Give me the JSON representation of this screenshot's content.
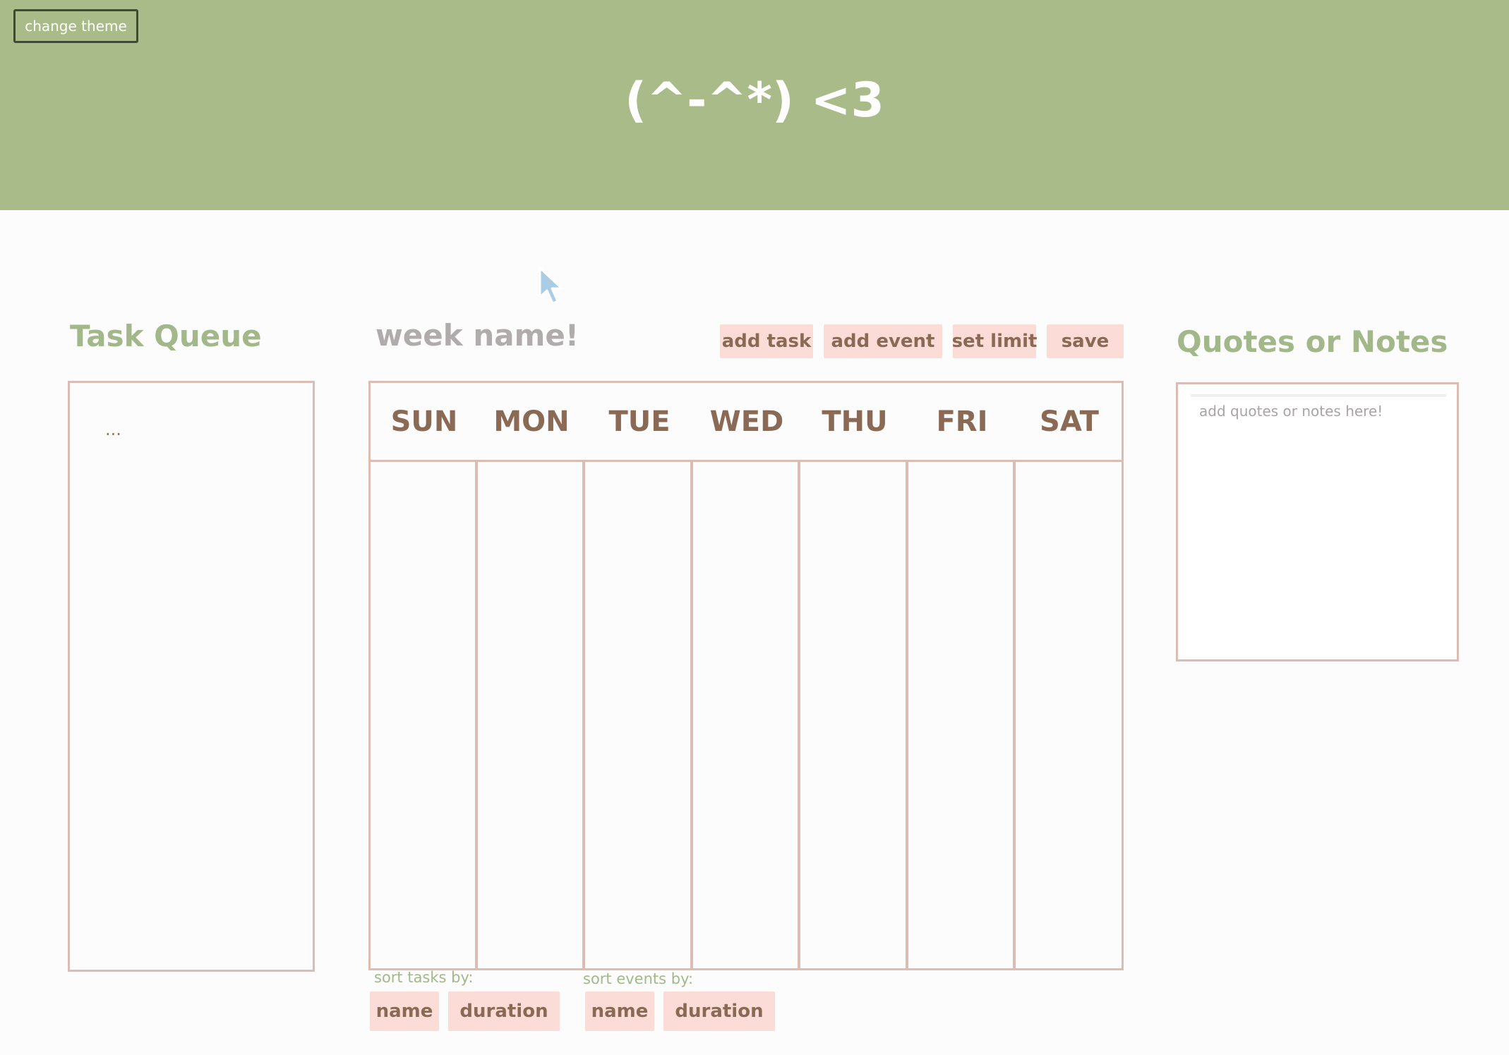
{
  "header": {
    "theme_button": "change theme",
    "title": "(^-^*) <3"
  },
  "task_queue": {
    "title": "Task Queue",
    "content": "..."
  },
  "week": {
    "name": "week name!"
  },
  "toolbar": {
    "add_task": "add task",
    "add_event": "add event",
    "set_limit": "set limit",
    "save": "save"
  },
  "days": [
    "SUN",
    "MON",
    "TUE",
    "WED",
    "THU",
    "FRI",
    "SAT"
  ],
  "sort_tasks": {
    "label": "sort tasks by:",
    "name": "name",
    "duration": "duration"
  },
  "sort_events": {
    "label": "sort events by:",
    "name": "name",
    "duration": "duration"
  },
  "notes": {
    "title": "Quotes or Notes",
    "placeholder": "add quotes or notes here!"
  },
  "colors": {
    "header_green": "#a8bb88",
    "heading_green": "#a2b88a",
    "button_pink": "#fbdcd7",
    "border_rose": "#dcbdb4",
    "day_brown": "#8a6a55"
  }
}
